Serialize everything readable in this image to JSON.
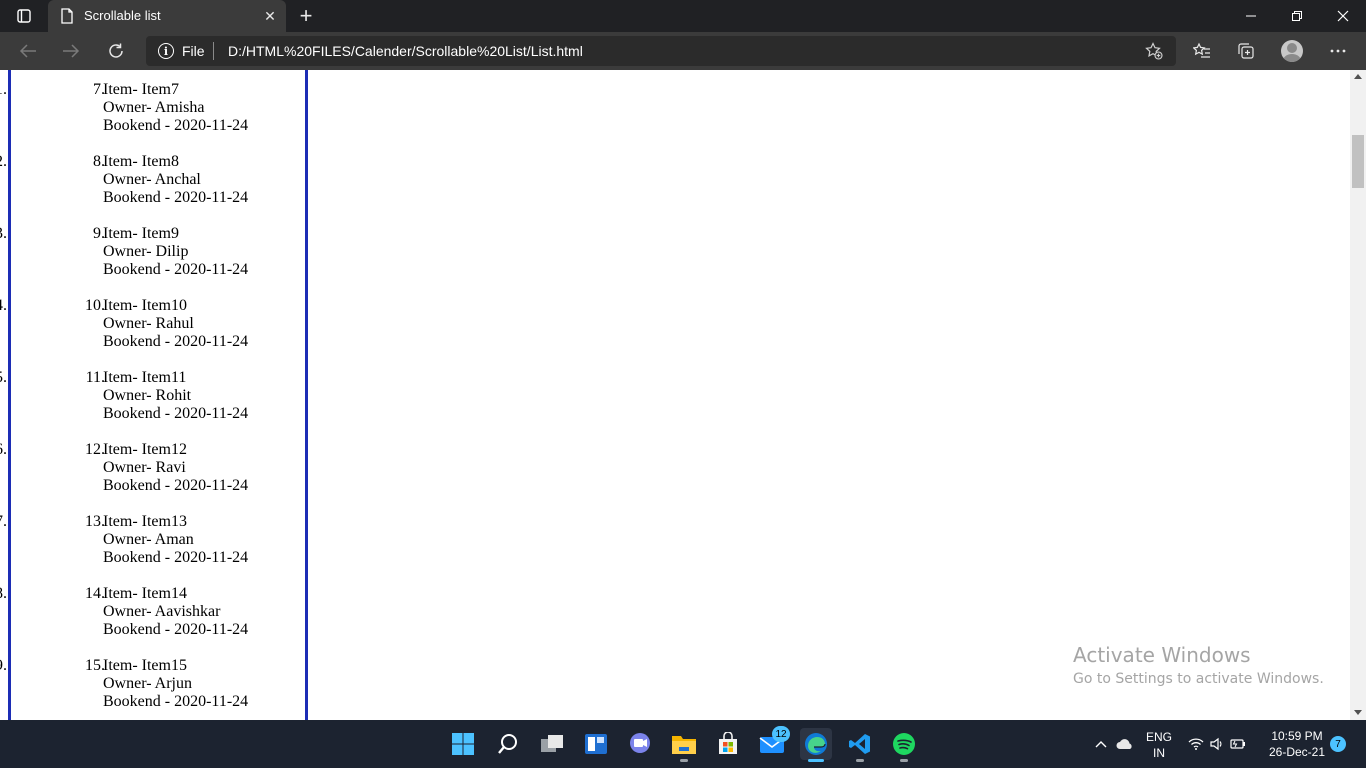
{
  "browser": {
    "tab_title": "Scrollable list",
    "new_tab_symbol": "+",
    "omnibox_scheme": "File",
    "url": "D:/HTML%20FILES/Calender/Scrollable%20List/List.html"
  },
  "list": {
    "items": [
      {
        "number": "7.",
        "item": "Item- Item7",
        "owner": "Owner- Amisha",
        "bookend": "Bookend - 2020-11-24"
      },
      {
        "number": "8.",
        "item": "Item- Item8",
        "owner": "Owner- Anchal",
        "bookend": "Bookend - 2020-11-24"
      },
      {
        "number": "9.",
        "item": "Item- Item9",
        "owner": "Owner- Dilip",
        "bookend": "Bookend - 2020-11-24"
      },
      {
        "number": "10.",
        "item": "Item- Item10",
        "owner": "Owner- Rahul",
        "bookend": "Bookend - 2020-11-24"
      },
      {
        "number": "11.",
        "item": "Item- Item11",
        "owner": "Owner- Rohit",
        "bookend": "Bookend - 2020-11-24"
      },
      {
        "number": "12.",
        "item": "Item- Item12",
        "owner": "Owner- Ravi",
        "bookend": "Bookend - 2020-11-24"
      },
      {
        "number": "13.",
        "item": "Item- Item13",
        "owner": "Owner- Aman",
        "bookend": "Bookend - 2020-11-24"
      },
      {
        "number": "14.",
        "item": "Item- Item14",
        "owner": "Owner- Aavishkar",
        "bookend": "Bookend - 2020-11-24"
      },
      {
        "number": "15.",
        "item": "Item- Item15",
        "owner": "Owner- Arjun",
        "bookend": "Bookend - 2020-11-24"
      }
    ],
    "border_color": "#1c2db5"
  },
  "watermark": {
    "title": "Activate Windows",
    "subtitle": "Go to Settings to activate Windows."
  },
  "taskbar": {
    "mail_badge": "12",
    "language": "ENG",
    "region": "IN",
    "time": "10:59 PM",
    "date": "26-Dec-21",
    "notification_count": "7",
    "apps": [
      "start-icon",
      "search-icon",
      "task-view-icon",
      "widgets-icon",
      "chat-icon",
      "file-explorer-icon",
      "store-icon",
      "mail-icon",
      "edge-icon",
      "vscode-icon",
      "spotify-icon"
    ]
  },
  "colors": {
    "accent": "#4cc2ff",
    "taskbar_bg": "#1c2330",
    "toolbar_bg": "#3b3b3b"
  }
}
